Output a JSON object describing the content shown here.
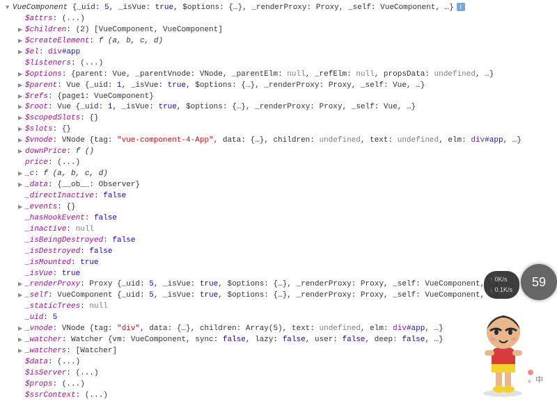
{
  "header": {
    "type": "VueComponent",
    "summary": "{_uid: 5, _isVue: true, $options: {…}, _renderProxy: Proxy, _self: VueComponent, …}"
  },
  "rows": [
    {
      "arrow": null,
      "key": "$attrs",
      "val": "(...)",
      "cls": "obj"
    },
    {
      "arrow": "r",
      "key": "$children",
      "val": "(2) [VueComponent, VueComponent]",
      "cls": "obj"
    },
    {
      "arrow": "r",
      "key": "$createElement",
      "val": "f (a, b, c, d)",
      "cls": "fn"
    },
    {
      "arrow": "r",
      "key": "$el",
      "val": "div#app",
      "cls": "el"
    },
    {
      "arrow": null,
      "key": "$listeners",
      "val": "(...)",
      "cls": "obj"
    },
    {
      "arrow": "r",
      "key": "$options",
      "val": "{parent: Vue, _parentVnode: VNode, _parentElm: null, _refElm: null, propsData: undefined, …}",
      "cls": "obj"
    },
    {
      "arrow": "r",
      "key": "$parent",
      "val": "Vue {_uid: 1, _isVue: true, $options: {…}, _renderProxy: Proxy, _self: Vue, …}",
      "cls": "obj"
    },
    {
      "arrow": "r",
      "key": "$refs",
      "val": "{page1: VueComponent}",
      "cls": "obj"
    },
    {
      "arrow": "r",
      "key": "$root",
      "val": "Vue {_uid: 1, _isVue: true, $options: {…}, _renderProxy: Proxy, _self: Vue, …}",
      "cls": "obj"
    },
    {
      "arrow": "r",
      "key": "$scopedSlots",
      "val": "{}",
      "cls": "obj"
    },
    {
      "arrow": "r",
      "key": "$slots",
      "val": "{}",
      "cls": "obj"
    },
    {
      "arrow": "r",
      "key": "$vnode",
      "val": "VNode {tag: \"vue-component-4-App\", data: {…}, children: undefined, text: undefined, elm: div#app, …}",
      "cls": "vnode"
    },
    {
      "arrow": "r",
      "key": "downPrice",
      "val": "f ()",
      "cls": "fn"
    },
    {
      "arrow": null,
      "key": "price",
      "val": "(...)",
      "cls": "obj"
    },
    {
      "arrow": "r",
      "key": "_c",
      "val": "f (a, b, c, d)",
      "cls": "fn"
    },
    {
      "arrow": "r",
      "key": "_data",
      "val": "{__ob__: Observer}",
      "cls": "obj"
    },
    {
      "arrow": null,
      "key": "_directInactive",
      "val": "false",
      "cls": "bool"
    },
    {
      "arrow": "r",
      "key": "_events",
      "val": "{}",
      "cls": "obj"
    },
    {
      "arrow": null,
      "key": "_hasHookEvent",
      "val": "false",
      "cls": "bool"
    },
    {
      "arrow": null,
      "key": "_inactive",
      "val": "null",
      "cls": "nul"
    },
    {
      "arrow": null,
      "key": "_isBeingDestroyed",
      "val": "false",
      "cls": "bool"
    },
    {
      "arrow": null,
      "key": "_isDestroyed",
      "val": "false",
      "cls": "bool"
    },
    {
      "arrow": null,
      "key": "_isMounted",
      "val": "true",
      "cls": "bool"
    },
    {
      "arrow": null,
      "key": "_isVue",
      "val": "true",
      "cls": "bool"
    },
    {
      "arrow": "r",
      "key": "_renderProxy",
      "val": "Proxy {_uid: 5, _isVue: true, $options: {…}, _renderProxy: Proxy, _self: VueComponent, …}",
      "cls": "obj"
    },
    {
      "arrow": "r",
      "key": "_self",
      "val": "VueComponent {_uid: 5, _isVue: true, $options: {…}, _renderProxy: Proxy, _self: VueComponent, …}",
      "cls": "obj"
    },
    {
      "arrow": null,
      "key": "_staticTrees",
      "val": "null",
      "cls": "nul"
    },
    {
      "arrow": null,
      "key": "_uid",
      "val": "5",
      "cls": "num"
    },
    {
      "arrow": "r",
      "key": "_vnode",
      "val": "VNode {tag: \"div\", data: {…}, children: Array(5), text: undefined, elm: div#app, …}",
      "cls": "vnode2"
    },
    {
      "arrow": "r",
      "key": "_watcher",
      "val": "Watcher {vm: VueComponent, sync: false, lazy: false, user: false, deep: false, …}",
      "cls": "obj"
    },
    {
      "arrow": "r",
      "key": "_watchers",
      "val": "[Watcher]",
      "cls": "obj"
    },
    {
      "arrow": null,
      "key": "$data",
      "val": "(...)",
      "cls": "obj"
    },
    {
      "arrow": null,
      "key": "$isServer",
      "val": "(...)",
      "cls": "obj"
    },
    {
      "arrow": null,
      "key": "$props",
      "val": "(...)",
      "cls": "obj"
    },
    {
      "arrow": null,
      "key": "$ssrContext",
      "val": "(...)",
      "cls": "obj"
    }
  ],
  "net": {
    "up": "0K/s",
    "down": "0.1K/s",
    "circle": "59"
  }
}
